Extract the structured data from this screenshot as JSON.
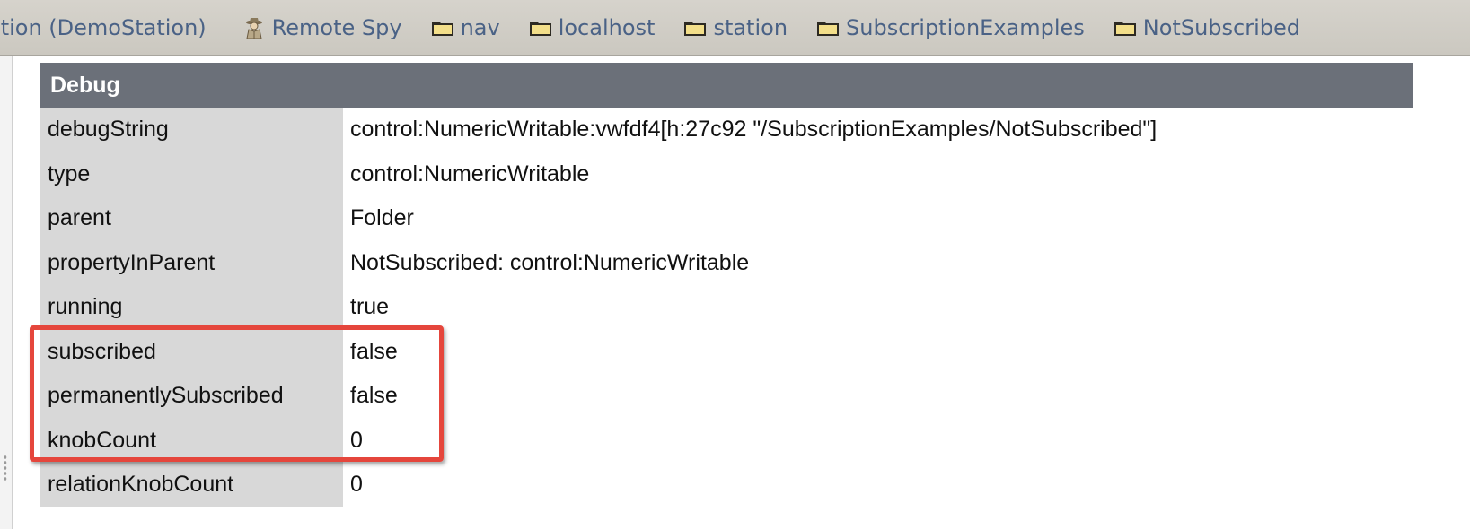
{
  "breadcrumbs": [
    {
      "label": "ation (DemoStation)",
      "icon": "none"
    },
    {
      "label": "Remote Spy",
      "icon": "spy-icon"
    },
    {
      "label": "nav",
      "icon": "folder-icon"
    },
    {
      "label": "localhost",
      "icon": "folder-icon"
    },
    {
      "label": "station",
      "icon": "folder-icon"
    },
    {
      "label": "SubscriptionExamples",
      "icon": "folder-icon"
    },
    {
      "label": "NotSubscribed",
      "icon": "folder-icon"
    }
  ],
  "debug": {
    "title": "Debug",
    "rows": [
      {
        "key": "debugString",
        "value": "control:NumericWritable:vwfdf4[h:27c92 \"/SubscriptionExamples/NotSubscribed\"]"
      },
      {
        "key": "type",
        "value": "control:NumericWritable"
      },
      {
        "key": "parent",
        "value": "Folder"
      },
      {
        "key": "propertyInParent",
        "value": "NotSubscribed: control:NumericWritable"
      },
      {
        "key": "running",
        "value": "true"
      },
      {
        "key": "subscribed",
        "value": "false"
      },
      {
        "key": "permanentlySubscribed",
        "value": "false"
      },
      {
        "key": "knobCount",
        "value": "0"
      },
      {
        "key": "relationKnobCount",
        "value": "0"
      }
    ]
  },
  "colors": {
    "header_bg": "#6b7079",
    "key_bg": "#d8d8d8",
    "highlight_border": "#e5463c",
    "crumb_text": "#4a6286"
  }
}
